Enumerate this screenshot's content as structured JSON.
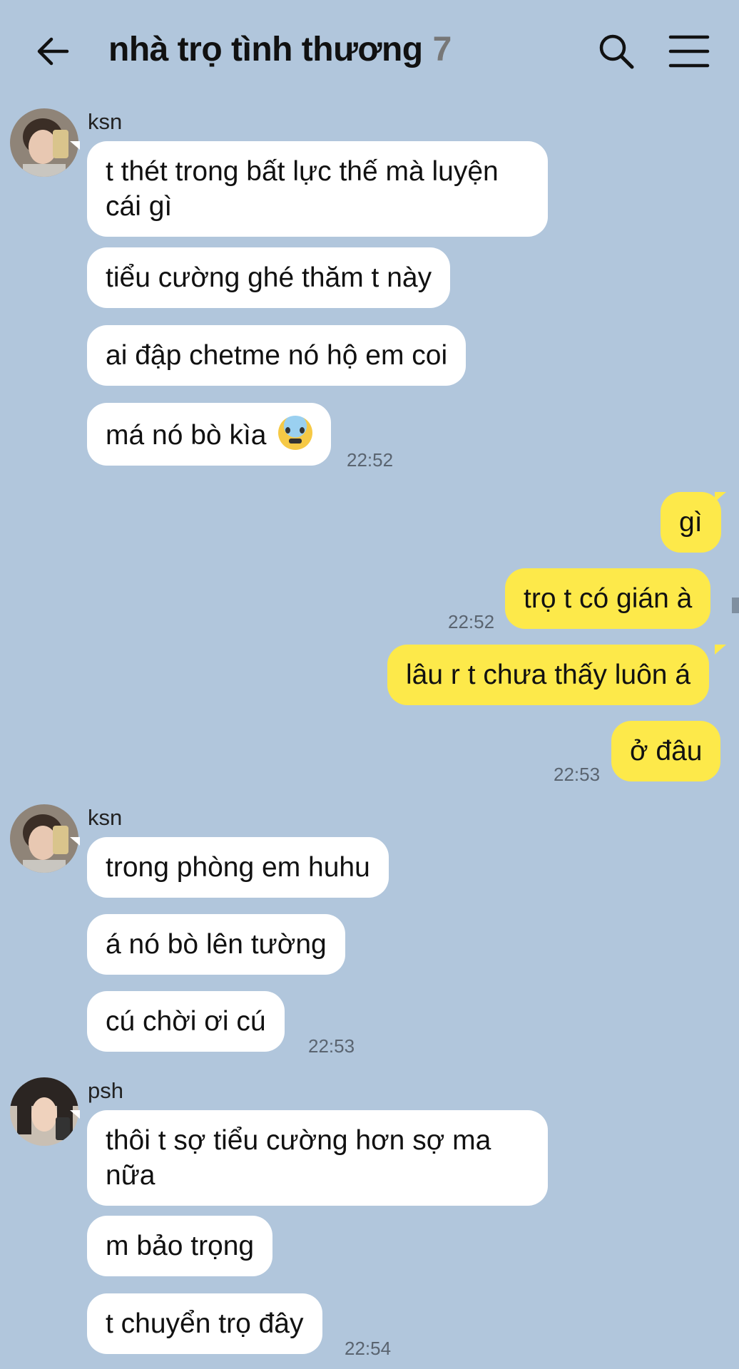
{
  "header": {
    "title": "nhà trọ tình thương",
    "member_count": "7",
    "back_icon": "arrow-left-icon",
    "search_icon": "search-icon",
    "menu_icon": "hamburger-menu-icon"
  },
  "colors": {
    "background": "#b1c6dc",
    "incoming_bubble": "#ffffff",
    "outgoing_bubble": "#fde94a",
    "timestamp": "#5a6470"
  },
  "groups": [
    {
      "sender": "ksn",
      "avatar_icon": "avatar-ksn",
      "messages": [
        "t thét trong bất lực thế mà luyện cái gì",
        "tiểu cường ghé thăm t này",
        "ai đập chetme nó hộ em coi",
        "má nó bò kìa"
      ],
      "emoji": "anxious-face-emoji",
      "time": "22:52"
    },
    {
      "sender": "me",
      "messages": [
        "gì",
        "trọ t có gián à"
      ],
      "time": "22:52"
    },
    {
      "sender": "me",
      "messages": [
        "lâu r t chưa thấy luôn á",
        "ở đâu"
      ],
      "time": "22:53"
    },
    {
      "sender": "ksn",
      "avatar_icon": "avatar-ksn",
      "messages": [
        "trong phòng em huhu",
        "á nó bò lên tường",
        "cú chời ơi cú"
      ],
      "time": "22:53"
    },
    {
      "sender": "psh",
      "avatar_icon": "avatar-psh",
      "messages": [
        "thôi t sợ tiểu cường hơn sợ ma nữa",
        "m bảo trọng",
        "t chuyển trọ đây"
      ],
      "time": "22:54"
    }
  ]
}
